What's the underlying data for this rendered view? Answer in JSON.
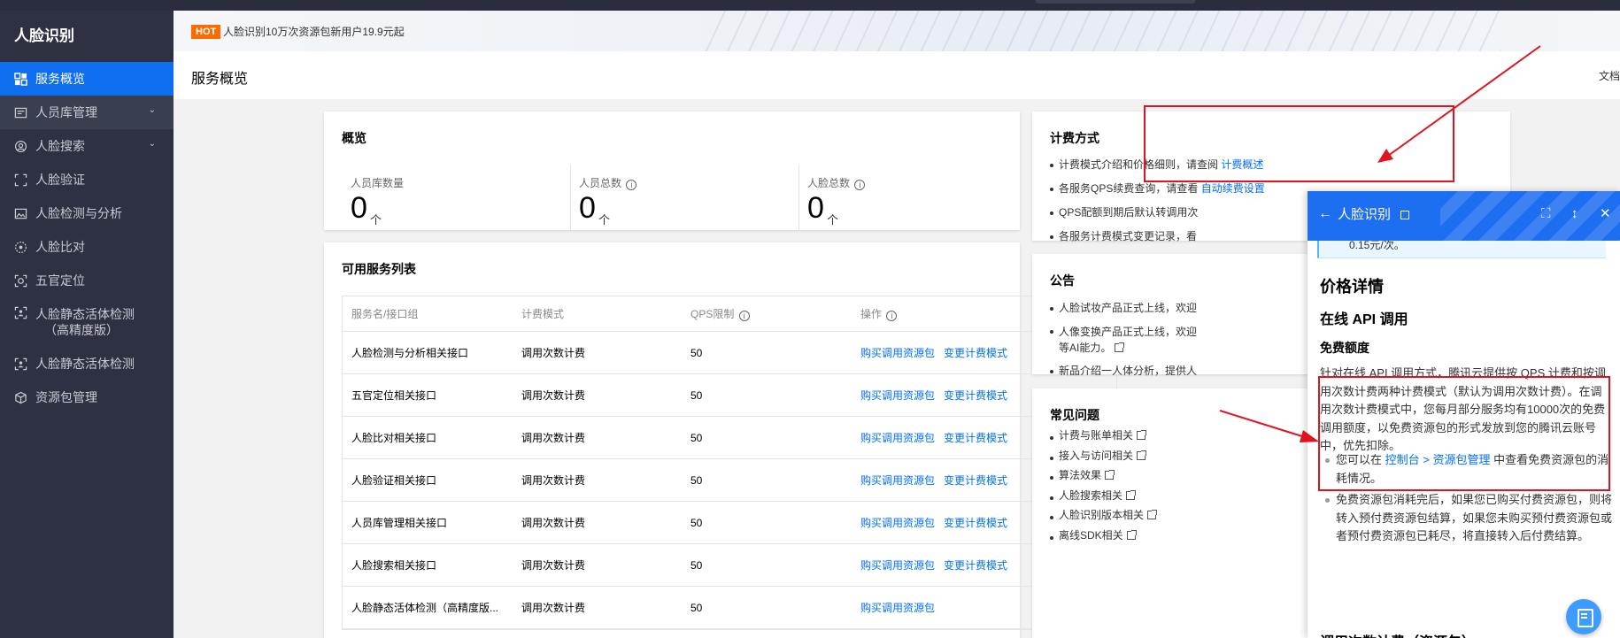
{
  "sidebar": {
    "title": "人脸识别",
    "items": [
      {
        "label": "服务概览",
        "icon": "dashboard-icon",
        "active": true
      },
      {
        "label": "人员库管理",
        "icon": "database-icon",
        "expandable": true
      },
      {
        "label": "人脸搜索",
        "icon": "face-search-icon",
        "expandable": true
      },
      {
        "label": "人脸验证",
        "icon": "scan-icon"
      },
      {
        "label": "人脸检测与分析",
        "icon": "image-icon"
      },
      {
        "label": "人脸比对",
        "icon": "compare-icon"
      },
      {
        "label": "五官定位",
        "icon": "face-locate-icon"
      },
      {
        "label": "人脸静态活体检测\n（高精度版）",
        "icon": "liveness-icon"
      },
      {
        "label": "人脸静态活体检测",
        "icon": "liveness-icon"
      },
      {
        "label": "资源包管理",
        "icon": "package-icon"
      }
    ]
  },
  "banner": {
    "badge": "HOT",
    "text": "人脸识别10万次资源包新用户19.9元起"
  },
  "header": {
    "title": "服务概览",
    "doc_link": "文档"
  },
  "overview": {
    "title": "概览",
    "stats": [
      {
        "label": "人员库数量",
        "value": "0",
        "unit": "个",
        "info": false
      },
      {
        "label": "人员总数",
        "value": "0",
        "unit": "个",
        "info": true
      },
      {
        "label": "人脸总数",
        "value": "0",
        "unit": "个",
        "info": true
      }
    ]
  },
  "services": {
    "title": "可用服务列表",
    "columns": [
      "服务名/接口组",
      "计费模式",
      "QPS限制",
      "操作"
    ],
    "rows": [
      {
        "name": "人脸检测与分析相关接口",
        "billing": "调用次数计费",
        "qps": "50",
        "actions": [
          "购买调用资源包",
          "变更计费模式"
        ]
      },
      {
        "name": "五官定位相关接口",
        "billing": "调用次数计费",
        "qps": "50",
        "actions": [
          "购买调用资源包",
          "变更计费模式"
        ]
      },
      {
        "name": "人脸比对相关接口",
        "billing": "调用次数计费",
        "qps": "50",
        "actions": [
          "购买调用资源包",
          "变更计费模式"
        ]
      },
      {
        "name": "人脸验证相关接口",
        "billing": "调用次数计费",
        "qps": "50",
        "actions": [
          "购买调用资源包",
          "变更计费模式"
        ]
      },
      {
        "name": "人员库管理相关接口",
        "billing": "调用次数计费",
        "qps": "50",
        "actions": [
          "购买调用资源包",
          "变更计费模式"
        ]
      },
      {
        "name": "人脸搜索相关接口",
        "billing": "调用次数计费",
        "qps": "50",
        "actions": [
          "购买调用资源包",
          "变更计费模式"
        ]
      },
      {
        "name": "人脸静态活体检测（高精度版...",
        "billing": "调用次数计费",
        "qps": "50",
        "actions": [
          "购买调用资源包"
        ]
      }
    ]
  },
  "billing": {
    "title": "计费方式",
    "items": [
      {
        "text": "计费模式介绍和价格细则，请查阅 ",
        "link": "计费概述"
      },
      {
        "text": "各服务QPS续费查询，请查看 ",
        "link": "自动续费设置"
      },
      {
        "text": "QPS配额到期后默认转调用次",
        "link": ""
      },
      {
        "text": "各服务计费模式变更记录，看",
        "link": ""
      }
    ]
  },
  "notice": {
    "title": "公告",
    "items": [
      "人脸试妆产品正式上线，欢迎",
      "人像变换产品正式上线，欢迎\n等AI能力。",
      "新品介绍一人体分析，提供人"
    ]
  },
  "faq": {
    "title": "常见问题",
    "items": [
      "计费与账单相关",
      "接入与访问相关",
      "算法效果",
      "人脸搜索相关",
      "人脸识别版本相关",
      "离线SDK相关"
    ]
  },
  "panel": {
    "back": "←",
    "title": "人脸识别",
    "controls": [
      "⛶",
      "↕",
      "✕"
    ],
    "tail_text": "0.15元/次。",
    "h1": "价格详情",
    "h2": "在线 API 调用",
    "h3": "免费额度",
    "para": "针对在线 API 调用方式，腾讯云提供按 QPS 计费和按调用次数计费两种计费模式（默认为调用次数计费）。在调用次数计费模式中，您每月部分服务均有10000次的免费调用额度，以免费资源包的形式发放到您的腾讯云账号中，优先扣除。",
    "list": [
      {
        "pre": "您可以在 ",
        "link": "控制台 > 资源包管理",
        "post": " 中查看免费资源包的消耗情况。"
      },
      {
        "pre": "免费资源包消耗完后，如果您已购买付费资源包，则将转入预付费资源包结算，如果您未购买预付费资源包或者预付费资源包已耗尽，将直接转入后付费结算。",
        "link": "",
        "post": ""
      }
    ],
    "cutoff": "调用次数计费（资源包）"
  },
  "colors": {
    "primary": "#006eff",
    "sidebar_bg": "#2d3141",
    "active": "#0f6ef0",
    "annotation": "#e0141e",
    "hot": "#ff6a00"
  }
}
